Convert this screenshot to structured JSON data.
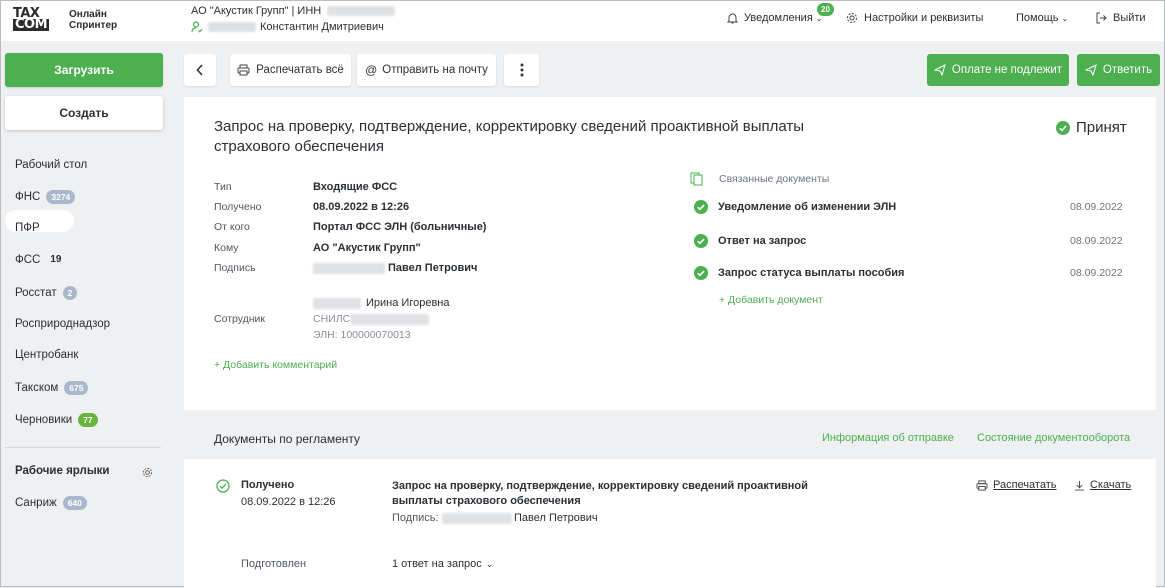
{
  "logo": {
    "line1": "TAX",
    "line2": "COM",
    "app1": "Онлайн",
    "app2": "Спринтер"
  },
  "header": {
    "org": "АО \"Акустик Групп\" | ИНН",
    "user": "Константин Дмитриевич",
    "notifications_label": "Уведомления",
    "notifications_count": "20",
    "settings_label": "Настройки и реквизиты",
    "help_label": "Помощь",
    "exit_label": "Выйти"
  },
  "sidebar": {
    "upload_label": "Загрузить",
    "create_label": "Создать",
    "items": [
      {
        "label": "Рабочий стол",
        "badge": ""
      },
      {
        "label": "ФНС",
        "badge": "3274"
      },
      {
        "label": "ПФР",
        "badge": ""
      },
      {
        "label": "ФСС",
        "badge": "19"
      },
      {
        "label": "Росстат",
        "badge": "2"
      },
      {
        "label": "Росприроднадзор",
        "badge": ""
      },
      {
        "label": "Центробанк",
        "badge": ""
      },
      {
        "label": "Такском",
        "badge": "675"
      },
      {
        "label": "Черновики",
        "badge": "77"
      }
    ],
    "labels_title": "Рабочие ярлыки",
    "label_items": [
      {
        "label": "Санриж",
        "badge": "640"
      }
    ]
  },
  "toolbar": {
    "print_all": "Распечатать всё",
    "send_mail": "Отправить на почту",
    "not_payable": "Оплате не подлежит",
    "reply": "Ответить"
  },
  "document": {
    "title": "Запрос на проверку, подтверждение, корректировку сведений проактивной выплаты страхового обеспечения",
    "status": "Принят",
    "fields": {
      "type_label": "Тип",
      "type": "Входящие ФСС",
      "received_label": "Получено",
      "received": "08.09.2022 в 12:26",
      "from_label": "От кого",
      "from": "Портал ФСС ЭЛН (больничные)",
      "to_label": "Кому",
      "to": "АО \"Акустик Групп\"",
      "sign_label": "Подпись",
      "sign": "Павел Петрович",
      "employee_label": "Сотрудник",
      "employee": "Ирина Игоревна",
      "snils": "СНИЛС:",
      "eln": "ЭЛН: 100000070013"
    },
    "add_comment": "+ Добавить комментарий",
    "related_title": "Связанные документы",
    "related": [
      {
        "title": "Уведомление об изменении ЭЛН",
        "date": "08.09.2022"
      },
      {
        "title": "Ответ на запрос",
        "date": "08.09.2022"
      },
      {
        "title": "Запрос статуса выплаты пособия",
        "date": "08.09.2022"
      }
    ],
    "add_document": "+ Добавить документ"
  },
  "regulation": {
    "title": "Документы по регламенту",
    "info_link": "Информация об отправке",
    "state_link": "Состояние документооборота",
    "entry": {
      "status": "Получено",
      "date": "08.09.2022 в 12:26",
      "doc_title": "Запрос на проверку, подтверждение, корректировку сведений проактивной выплаты страхового обеспечения",
      "sign_label": "Подпись:",
      "sign_name": "Павел Петрович",
      "print": "Распечатать",
      "download": "Скачать"
    },
    "prepared_label": "Подготовлен",
    "prepared_value": "1 ответ на запрос"
  },
  "colors": {
    "accent": "#4caf50",
    "badge_blue": "#a9b8cc"
  }
}
